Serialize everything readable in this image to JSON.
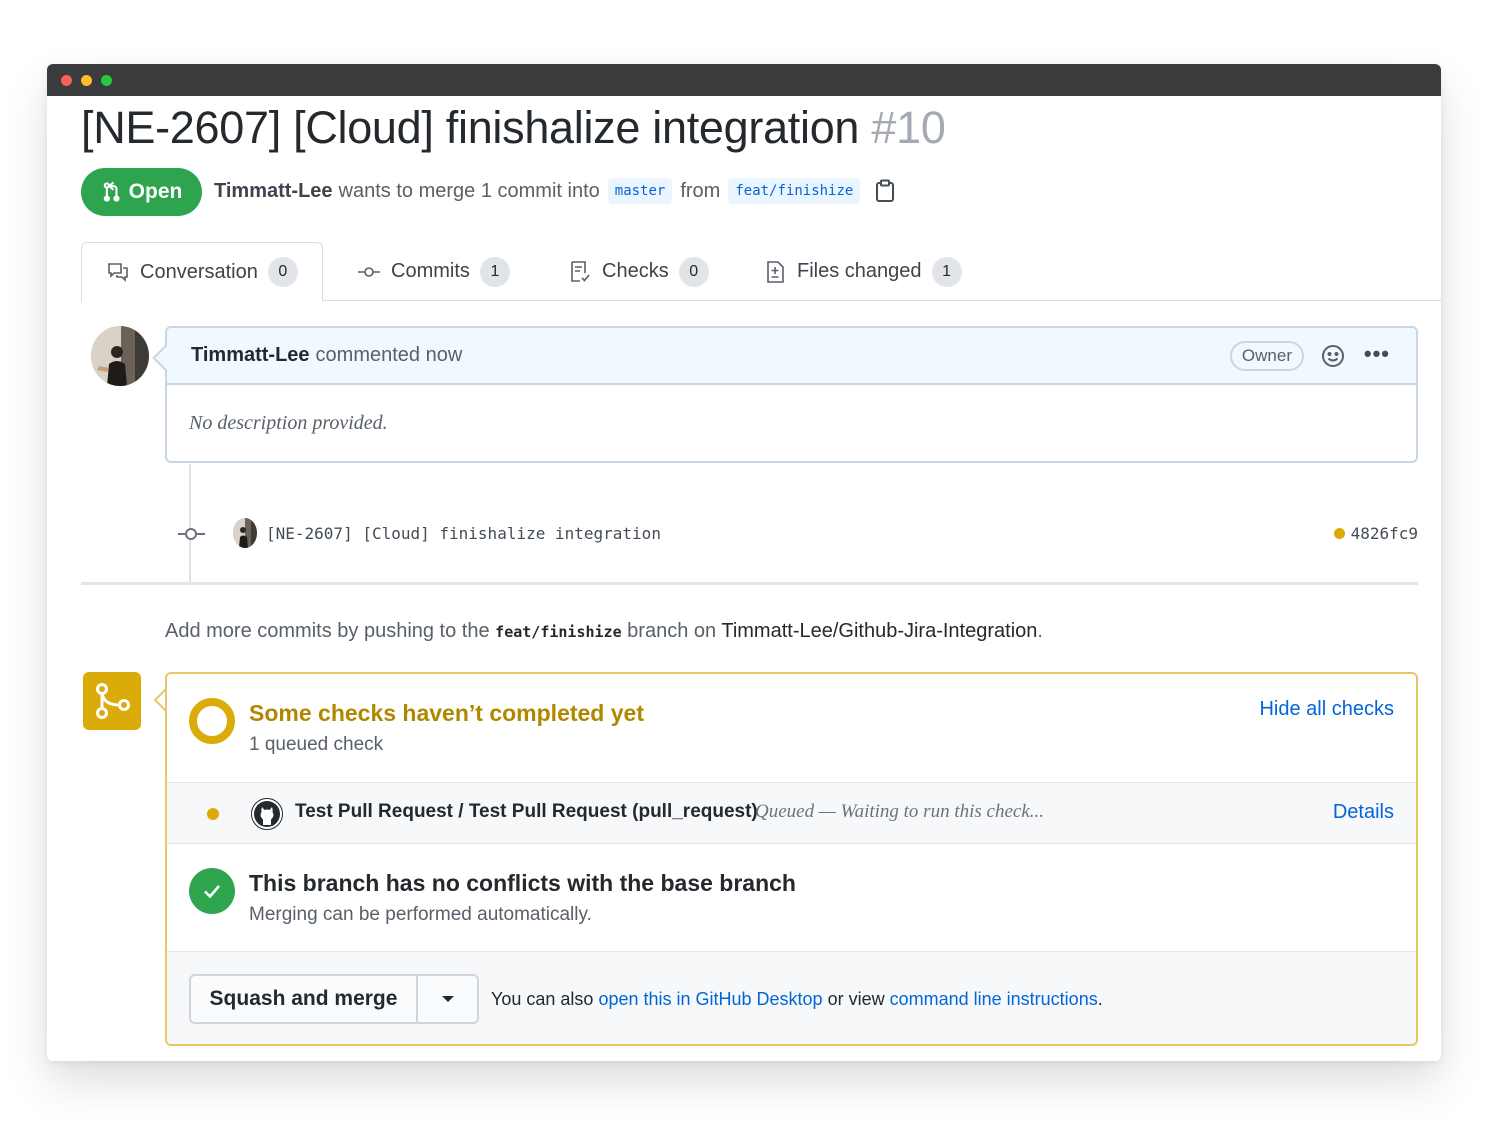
{
  "pr": {
    "title": "[NE-2607] [Cloud] finishalize integration",
    "number": "#10",
    "state": "Open",
    "author": "Timmatt-Lee",
    "merge_text": "wants to merge 1 commit into",
    "base_branch": "master",
    "from_text": "from",
    "head_branch": "feat/finishize"
  },
  "tabs": [
    {
      "label": "Conversation",
      "count": "0",
      "icon": "comment-discussion-icon"
    },
    {
      "label": "Commits",
      "count": "1",
      "icon": "git-commit-icon"
    },
    {
      "label": "Checks",
      "count": "0",
      "icon": "checklist-icon"
    },
    {
      "label": "Files changed",
      "count": "1",
      "icon": "file-diff-icon"
    }
  ],
  "comment": {
    "author": "Timmatt-Lee",
    "action": "commented now",
    "badge": "Owner",
    "body": "No description provided."
  },
  "commit": {
    "message": "[NE-2607] [Cloud] finishalize integration",
    "sha": "4826fc9"
  },
  "push_note": {
    "prefix": "Add more commits by pushing to the",
    "branch": "feat/finishize",
    "middle": "branch on",
    "repo": "Timmatt-Lee/Github-Jira-Integration",
    "suffix": "."
  },
  "checks": {
    "title": "Some checks haven’t completed yet",
    "subtitle": "1 queued check",
    "hide_link": "Hide all checks",
    "item_name": "Test Pull Request / Test Pull Request (pull_request)",
    "item_status": "Queued — Waiting to run this check...",
    "details_link": "Details"
  },
  "conflicts": {
    "title": "This branch has no conflicts with the base branch",
    "subtitle": "Merging can be performed automatically."
  },
  "merge": {
    "button_label": "Squash and merge",
    "also_prefix": "You can also",
    "desktop_link": "open this in GitHub Desktop",
    "or_view": "or view",
    "cli_link": "command line instructions",
    "suffix": "."
  },
  "colors": {
    "open_green": "#2ea44f",
    "pending_yellow": "#dbab09",
    "link_blue": "#0366d6",
    "titlebar": "#3a3b3c"
  }
}
